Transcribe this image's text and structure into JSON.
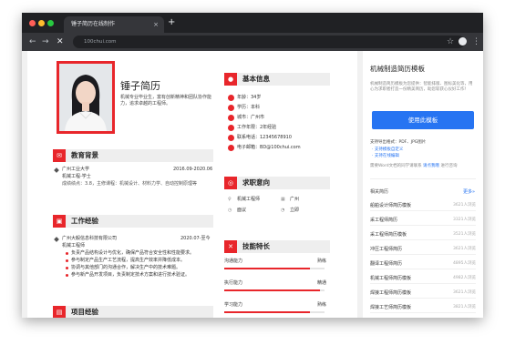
{
  "browser": {
    "tab_title": "锤子简历在线制作",
    "tab_close": "×",
    "new_tab": "+",
    "url": "100chui.com",
    "back": "←",
    "forward": "→",
    "reload": "✕",
    "star": "☆",
    "menu": "⋮"
  },
  "resume": {
    "name": "锤子简历",
    "intro": "机械专业毕业生，富有创新精神和团队协作能力，追求卓越的工程师。",
    "education": {
      "title": "教育背景",
      "school": "广州工业大学",
      "date": "2016.09-2020.06",
      "major": "机械工程-学士",
      "detail": "成绩绩点：3.8，主修课程：机械设计、材料力学、自动控制原理等"
    },
    "work": {
      "title": "工作经验",
      "company": "广州大毅信息科技有限公司",
      "date": "2020.07-至今",
      "role": "机械工程师",
      "bullets": [
        "负责产品结构设计与优化，确保产品符合安全性和性能要求。",
        "参与制定产品生产工艺流程，提高生产效率并降低成本。",
        "协调与其他部门的沟通合作，解决生产中的技术难题。",
        "参与新产品开发项目，负责制定技术方案和进行技术验证。"
      ]
    },
    "projects": {
      "title": "项目经验"
    },
    "basic": {
      "title": "基本信息",
      "items": [
        "年龄：34岁",
        "学历：本科",
        "城市：广州市",
        "工作年限：2年经验",
        "联系电话：12345678910",
        "电子邮箱：BD@100chui.com"
      ]
    },
    "intention": {
      "title": "求职意向",
      "job": "机械工程师",
      "city": "广州",
      "salary": "面议",
      "status": "立即"
    },
    "skills": {
      "title": "技能特长",
      "items": [
        {
          "name": "沟通能力",
          "level_text": "熟练",
          "level": 0.85
        },
        {
          "name": "执行能力",
          "level_text": "精通",
          "level": 0.95
        },
        {
          "name": "学习能力",
          "level_text": "熟练",
          "level": 0.85
        }
      ]
    }
  },
  "sidebar": {
    "title": "机械制造简历模板",
    "desc": "机械制造简历模板为您提供：智能排版、图标美化等，用心为求职者打造一份精美简历，助您斩获心仪好工作！",
    "use_button": "使用此模板",
    "format_title": "支持导出格式：PDF、JPG图片",
    "format_items": [
      "· 支持模板自定义",
      "· 支持在线编辑"
    ],
    "word_note": "需要Word文档的同学请联系",
    "word_link": "请点我哦",
    "word_suffix": "进行咨询",
    "related_title": "相关简历",
    "more": "更多»",
    "related": [
      {
        "name": "船舶设计师简历模板",
        "count": "3621人浏览"
      },
      {
        "name": "采工程师简历",
        "count": "3321人浏览"
      },
      {
        "name": "采工程师简历模板",
        "count": "3521人浏览"
      },
      {
        "name": "冲压工程师简历",
        "count": "3621人浏览"
      },
      {
        "name": "翻译工程师简历",
        "count": "4895人浏览"
      },
      {
        "name": "机械工程师简历模板",
        "count": "4982人浏览"
      },
      {
        "name": "焊接工程师简历模板",
        "count": "3621人浏览"
      },
      {
        "name": "焊接工艺师简历模板",
        "count": "3821人浏览"
      }
    ]
  }
}
